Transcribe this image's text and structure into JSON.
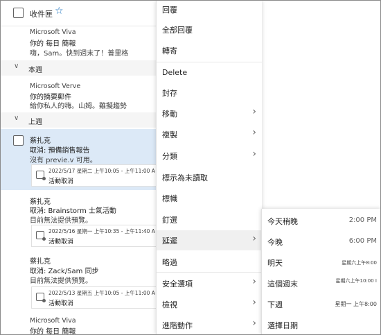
{
  "list": {
    "folder": "收件匣",
    "messages": [
      {
        "sender": "Microsoft Viva",
        "subject": "你的 每日 簡報",
        "preview": "嗨，Sam。快到週末了！普里格"
      },
      {
        "sender": "Microsoft Verve",
        "subject": "你的摘要郵件",
        "preview": "給你私人的嗨。山姆。雖擬趨勢"
      },
      {
        "sender": "蔡扎克",
        "subject": "取消: 預備銷售報告",
        "preview": "沒有 previe.v 可用。",
        "meeting_time": "2022/5/17 星期二 上午10:05 - 上午11:00 A",
        "meeting_status": "活動取消"
      },
      {
        "sender": "蔡扎克",
        "subject": "取消: Brainstorm 士氣活動",
        "preview": "目前無法提供預覽。",
        "meeting_time": "2022/5/16 星期一 上午10:35 - 上午11:40 A",
        "meeting_status": "活動取消"
      },
      {
        "sender": "蔡扎克",
        "subject": "取消: Zack/Sam 同步",
        "preview": "目前無法提供預覽。",
        "meeting_time": "2022/5/13 星期五 上午10:05 - 上午11:00 A",
        "meeting_status": "活動取消"
      },
      {
        "sender": "Microsoft Viva",
        "subject": "你的 每日 簡報"
      }
    ],
    "sections": {
      "this_week": "本週",
      "last_week": "上週"
    }
  },
  "menu": {
    "items": [
      "回覆",
      "全部回覆",
      "轉寄",
      "Delete",
      "封存",
      "移動",
      "複製",
      "分類",
      "標示為未讀取",
      "標幟",
      "釘選",
      "延遲",
      "略過",
      "安全選項",
      "檢視",
      "進階動作"
    ]
  },
  "snooze": {
    "items": [
      {
        "label": "今天稍晚",
        "time": "2:00 PM"
      },
      {
        "label": "今晚",
        "time": "6:00 PM"
      },
      {
        "label": "明天",
        "time": "星期六上午8:00"
      },
      {
        "label": "這個週末",
        "time": "星期六上午10:00 I"
      },
      {
        "label": "下週",
        "time": "星期一 上午8:00"
      },
      {
        "label": "選擇日期",
        "time": ""
      }
    ]
  }
}
